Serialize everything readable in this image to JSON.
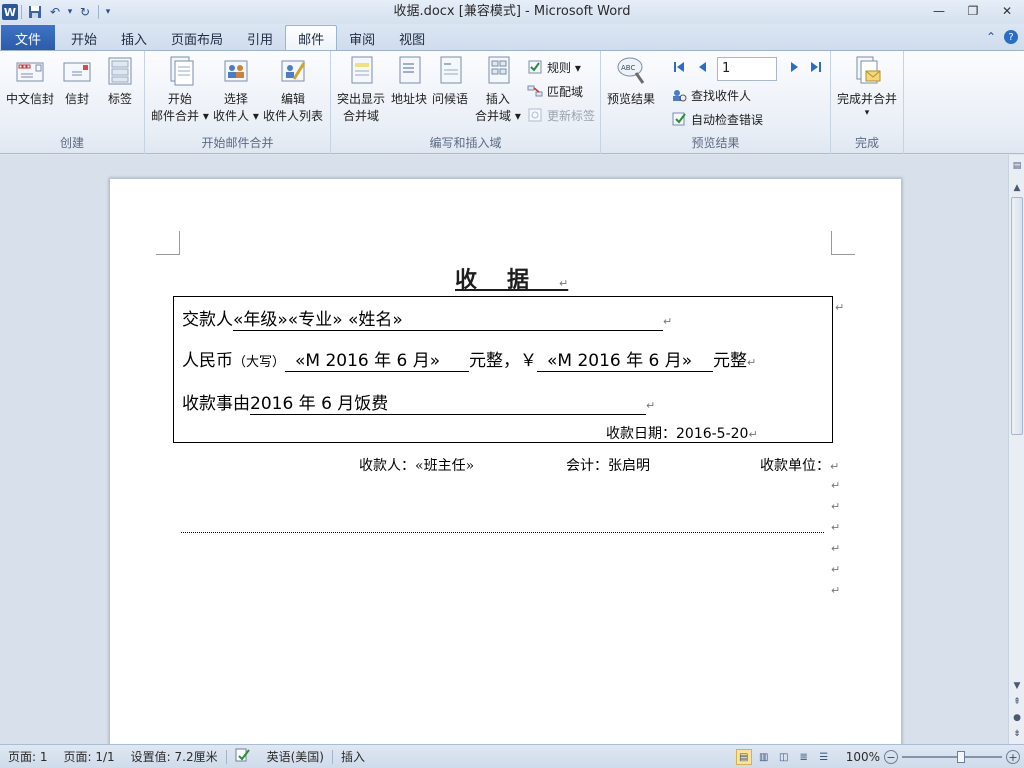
{
  "window": {
    "title": "收据.docx [兼容模式] - Microsoft Word",
    "app_icon": "W",
    "controls": {
      "minimize": "—",
      "restore": "❐",
      "close": "✕"
    }
  },
  "qat": {
    "save": "💾",
    "undo": "↶",
    "undo_dd": "▾",
    "redo": "↻",
    "customize": "▾"
  },
  "tabs": {
    "file": "文件",
    "items": [
      "开始",
      "插入",
      "页面布局",
      "引用",
      "邮件",
      "审阅",
      "视图"
    ],
    "active": "邮件",
    "right": {
      "collapse": "⌃",
      "help": "?"
    }
  },
  "ribbon": {
    "groups": {
      "create": {
        "label": "创建",
        "buttons": [
          "中文信封",
          "信封",
          "标签"
        ]
      },
      "start_merge": {
        "label": "开始邮件合并",
        "start": [
          "开始",
          "邮件合并 ▾"
        ],
        "select": [
          "选择",
          "收件人 ▾"
        ],
        "edit": [
          "编辑",
          "收件人列表"
        ]
      },
      "write_insert": {
        "label": "编写和插入域",
        "highlight": [
          "突出显示",
          "合并域"
        ],
        "address": "地址块",
        "greeting": "问候语",
        "insert": [
          "插入",
          "合并域 ▾"
        ],
        "rules": "规则 ▾",
        "match": "匹配域",
        "update": "更新标签"
      },
      "preview": {
        "label": "预览结果",
        "preview_btn": "预览结果",
        "record": "1",
        "find": "查找收件人",
        "check": "自动检查错误"
      },
      "finish": {
        "label": "完成",
        "finish_btn": "完成并合并",
        "finish_dd": "▾"
      }
    }
  },
  "document": {
    "title": "收据",
    "para_mark": "↵",
    "line1": {
      "label": "交款人",
      "value": "«年级»«专业» «姓名»"
    },
    "line2": {
      "label": "人民币",
      "small": "（大写）",
      "value": "«M 2016 年 6 月»",
      "suffix": "元整，",
      "yen": "￥",
      "value2": "«M 2016 年 6 月»",
      "suffix2": "元整"
    },
    "line3": {
      "label": "收款事由",
      "value": "2016 年 6 月饭费"
    },
    "date": {
      "label": "收款日期：",
      "value": "2016-5-20"
    },
    "footer": {
      "receiver_label": "收款人：",
      "receiver": "«班主任»",
      "accountant_label": "会计：",
      "accountant": "张启明",
      "unit_label": "收款单位："
    }
  },
  "statusbar": {
    "page": "页面: 1",
    "pages": "页面: 1/1",
    "setting": "设置值: 7.2厘米",
    "language": "英语(美国)",
    "mode": "插入",
    "zoom": "100%",
    "zoom_level": 0.6,
    "zoom_minus": "−",
    "zoom_plus": "+"
  },
  "colors": {
    "file_tab": "#2b5aa8",
    "ribbon_bg": "#e8eef6",
    "page_bg": "#ffffff",
    "doc_bg": "#d7e0eb"
  }
}
